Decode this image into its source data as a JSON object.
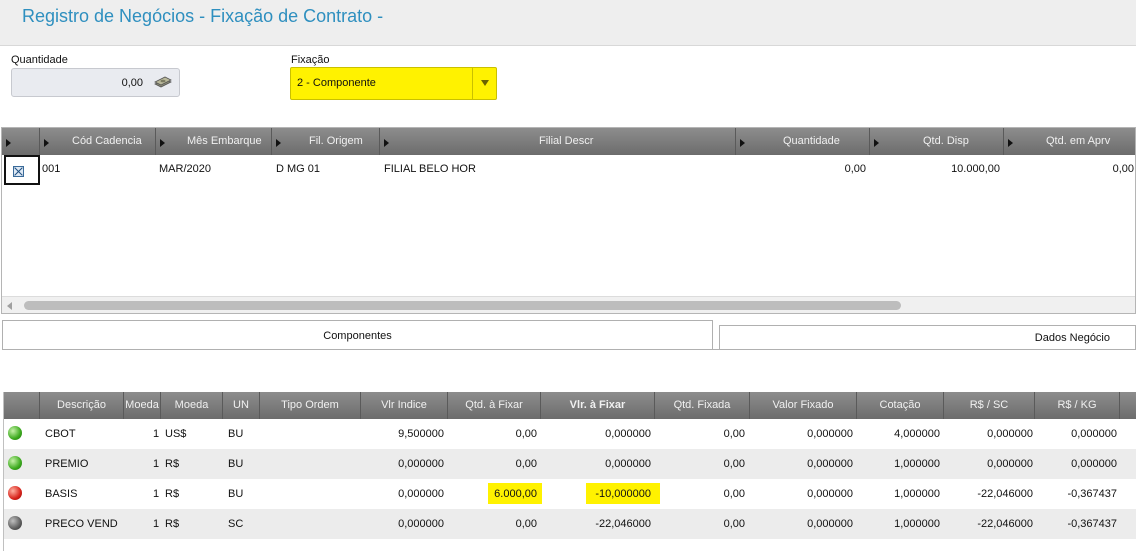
{
  "header": {
    "title": "Registro de Negócios - Fixação de Contrato -"
  },
  "form": {
    "quantidade_label": "Quantidade",
    "quantidade_value": "0,00",
    "fixacao_label": "Fixação",
    "fixacao_value": "2 - Componente"
  },
  "cadencia_grid": {
    "columns": [
      "Cód Cadencia",
      "Mês Embarque",
      "Fil. Origem",
      "Filial Descr",
      "Quantidade",
      "Qtd. Disp",
      "Qtd. em Aprv"
    ],
    "rows": [
      {
        "cod": "001",
        "mes": "MAR/2020",
        "fil": "D MG 01",
        "descr": "FILIAL BELO HOR",
        "quantidade": "0,00",
        "disp": "10.000,00",
        "aprv": "0,00"
      }
    ]
  },
  "tabs": {
    "componentes": "Componentes",
    "dados_negocio": "Dados Negócio"
  },
  "componentes_grid": {
    "columns": [
      "Descrição",
      "Moeda",
      "Moeda",
      "UN",
      "Tipo Ordem",
      "Vlr Indice",
      "Qtd. à Fixar",
      "Vlr. à Fixar",
      "Qtd. Fixada",
      "Valor Fixado",
      "Cotação",
      "R$ / SC",
      "R$ / KG"
    ],
    "rows": [
      {
        "status": "green",
        "descricao": "CBOT",
        "moeda_num": "1",
        "moeda": "US$",
        "un": "BU",
        "tipo": "",
        "indice": "9,500000",
        "qtd_fixar": "0,00",
        "vlr_fixar": "0,000000",
        "qtd_fixada": "0,00",
        "valor_fixado": "0,000000",
        "cotacao": "4,000000",
        "rs_sc": "0,000000",
        "rs_kg": "0,000000"
      },
      {
        "status": "green",
        "descricao": "PREMIO",
        "moeda_num": "1",
        "moeda": "R$",
        "un": "BU",
        "tipo": "",
        "indice": "0,000000",
        "qtd_fixar": "0,00",
        "vlr_fixar": "0,000000",
        "qtd_fixada": "0,00",
        "valor_fixado": "0,000000",
        "cotacao": "1,000000",
        "rs_sc": "0,000000",
        "rs_kg": "0,000000"
      },
      {
        "status": "red",
        "descricao": "BASIS",
        "moeda_num": "1",
        "moeda": "R$",
        "un": "BU",
        "tipo": "",
        "indice": "0,000000",
        "qtd_fixar": "6.000,00",
        "vlr_fixar": "-10,000000",
        "qtd_fixada": "0,00",
        "valor_fixado": "0,000000",
        "cotacao": "1,000000",
        "rs_sc": "-22,046000",
        "rs_kg": "-0,367437"
      },
      {
        "status": "grey",
        "descricao": "PRECO VEND",
        "moeda_num": "1",
        "moeda": "R$",
        "un": "SC",
        "tipo": "",
        "indice": "0,000000",
        "qtd_fixar": "0,00",
        "vlr_fixar": "-22,046000",
        "qtd_fixada": "0,00",
        "valor_fixado": "0,000000",
        "cotacao": "1,000000",
        "rs_sc": "-22,046000",
        "rs_kg": "-0,367437"
      }
    ]
  },
  "colors": {
    "title": "#2e8fbf",
    "highlight": "#fff200",
    "header_bg": "#7a7a7a"
  }
}
